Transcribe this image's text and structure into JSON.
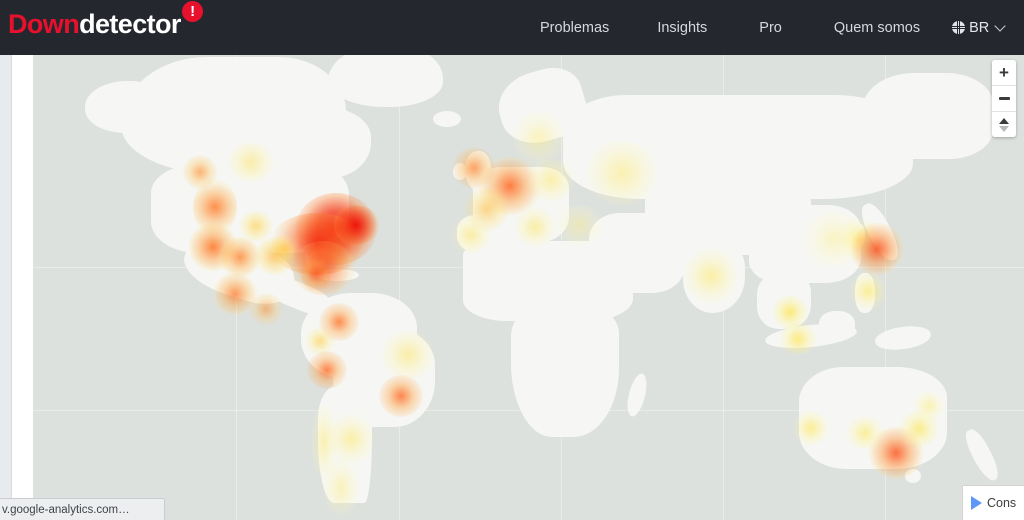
{
  "header": {
    "logo": {
      "part1": "Down",
      "part2": "detector",
      "badge": "!"
    },
    "nav": [
      {
        "label": "Problemas"
      },
      {
        "label": "Insights"
      },
      {
        "label": "Pro"
      },
      {
        "label": "Quem somos"
      }
    ],
    "language": {
      "label": "BR",
      "icon": "globe-icon",
      "chevron": "chevron-down-icon"
    },
    "bg_color": "#24272e",
    "accent_color": "#e8112d"
  },
  "map": {
    "type": "world-outage-heatmap",
    "ocean_color": "#dde1de",
    "land_color": "#f6f7f4",
    "border_color": "#d2d6d2",
    "controls": {
      "zoom_in": "+",
      "zoom_out": "−",
      "compass": "compass-icon"
    },
    "legend_scale": [
      "#ffe94d",
      "#ffa93c",
      "#ff6a1f",
      "#f01b0a"
    ],
    "hotspots": [
      {
        "region": "US Northeast",
        "intensity": "very-high",
        "color": "#f01b0a"
      },
      {
        "region": "US Midwest / Great Lakes",
        "intensity": "high",
        "color": "#f4300e"
      },
      {
        "region": "US Southeast",
        "intensity": "medium",
        "color": "#ff7a26"
      },
      {
        "region": "US West Coast",
        "intensity": "medium",
        "color": "#ff7f2a"
      },
      {
        "region": "US Mountain / Southwest",
        "intensity": "medium",
        "color": "#ff8c33"
      },
      {
        "region": "Texas",
        "intensity": "low",
        "color": "#ffd94d"
      },
      {
        "region": "Mexico",
        "intensity": "medium",
        "color": "#ff9a3c"
      },
      {
        "region": "Canada Prairies",
        "intensity": "low",
        "color": "#ffe86b"
      },
      {
        "region": "Colombia / Venezuela",
        "intensity": "medium",
        "color": "#ff7f2a"
      },
      {
        "region": "Peru",
        "intensity": "medium",
        "color": "#ff6f22"
      },
      {
        "region": "Brazil – São Paulo",
        "intensity": "medium",
        "color": "#ff7326"
      },
      {
        "region": "Brazil – Northeast",
        "intensity": "low",
        "color": "#ffec80"
      },
      {
        "region": "Argentina / Chile",
        "intensity": "low",
        "color": "#ffef8c"
      },
      {
        "region": "United Kingdom",
        "intensity": "medium",
        "color": "#ff8a33"
      },
      {
        "region": "Germany / Benelux",
        "intensity": "high",
        "color": "#ff6a1f"
      },
      {
        "region": "France",
        "intensity": "low",
        "color": "#ffe96b"
      },
      {
        "region": "Spain / Portugal",
        "intensity": "low",
        "color": "#ffef8c"
      },
      {
        "region": "Italy",
        "intensity": "low",
        "color": "#ffef8c"
      },
      {
        "region": "Poland / Eastern Europe",
        "intensity": "low",
        "color": "#ffee7a"
      },
      {
        "region": "Russia – European",
        "intensity": "low",
        "color": "#ffee7a"
      },
      {
        "region": "Scandinavia",
        "intensity": "low",
        "color": "#fff0a0"
      },
      {
        "region": "Turkey / Middle East",
        "intensity": "low",
        "color": "#fff0a0"
      },
      {
        "region": "India",
        "intensity": "low",
        "color": "#ffee80"
      },
      {
        "region": "Singapore / Malaysia",
        "intensity": "low",
        "color": "#ffe95c"
      },
      {
        "region": "Indonesia – Jakarta",
        "intensity": "low",
        "color": "#ffe95c"
      },
      {
        "region": "Philippines",
        "intensity": "low",
        "color": "#ffec70"
      },
      {
        "region": "China East",
        "intensity": "low",
        "color": "#fff0a0"
      },
      {
        "region": "Korea",
        "intensity": "low",
        "color": "#ffeb70"
      },
      {
        "region": "Japan – Tokyo",
        "intensity": "high",
        "color": "#ff5f1a"
      },
      {
        "region": "Australia – Melbourne",
        "intensity": "high",
        "color": "#ff5f1a"
      },
      {
        "region": "Australia – Sydney",
        "intensity": "low",
        "color": "#ffe95c"
      },
      {
        "region": "Australia – Perth",
        "intensity": "low",
        "color": "#ffe95c"
      },
      {
        "region": "Australia – Adelaide",
        "intensity": "low",
        "color": "#ffeb6b"
      }
    ]
  },
  "overlay": {
    "consent_widget": {
      "label": "Cons",
      "icon": "play-triangle-icon"
    }
  },
  "browser": {
    "status_text": "v.google-analytics.com…"
  }
}
